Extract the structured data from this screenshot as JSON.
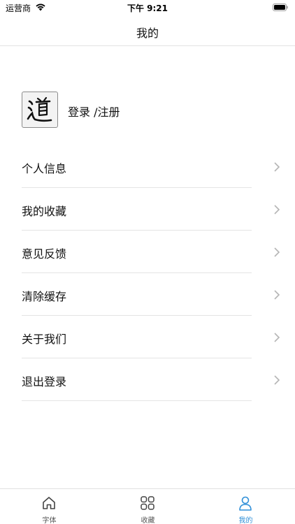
{
  "status_bar": {
    "carrier": "运营商",
    "time": "下午 9:21"
  },
  "nav": {
    "title": "我的"
  },
  "profile": {
    "login_label": "登录 /注册"
  },
  "menu": {
    "items": [
      {
        "label": "个人信息"
      },
      {
        "label": "我的收藏"
      },
      {
        "label": "意见反馈"
      },
      {
        "label": "清除缓存"
      },
      {
        "label": "关于我们"
      },
      {
        "label": "退出登录"
      }
    ]
  },
  "tab_bar": {
    "tabs": [
      {
        "label": "字体",
        "icon": "home-icon"
      },
      {
        "label": "收藏",
        "icon": "grid-icon"
      },
      {
        "label": "我的",
        "icon": "person-icon"
      }
    ],
    "active_color": "#2f8fd8",
    "inactive_color": "#555555"
  }
}
